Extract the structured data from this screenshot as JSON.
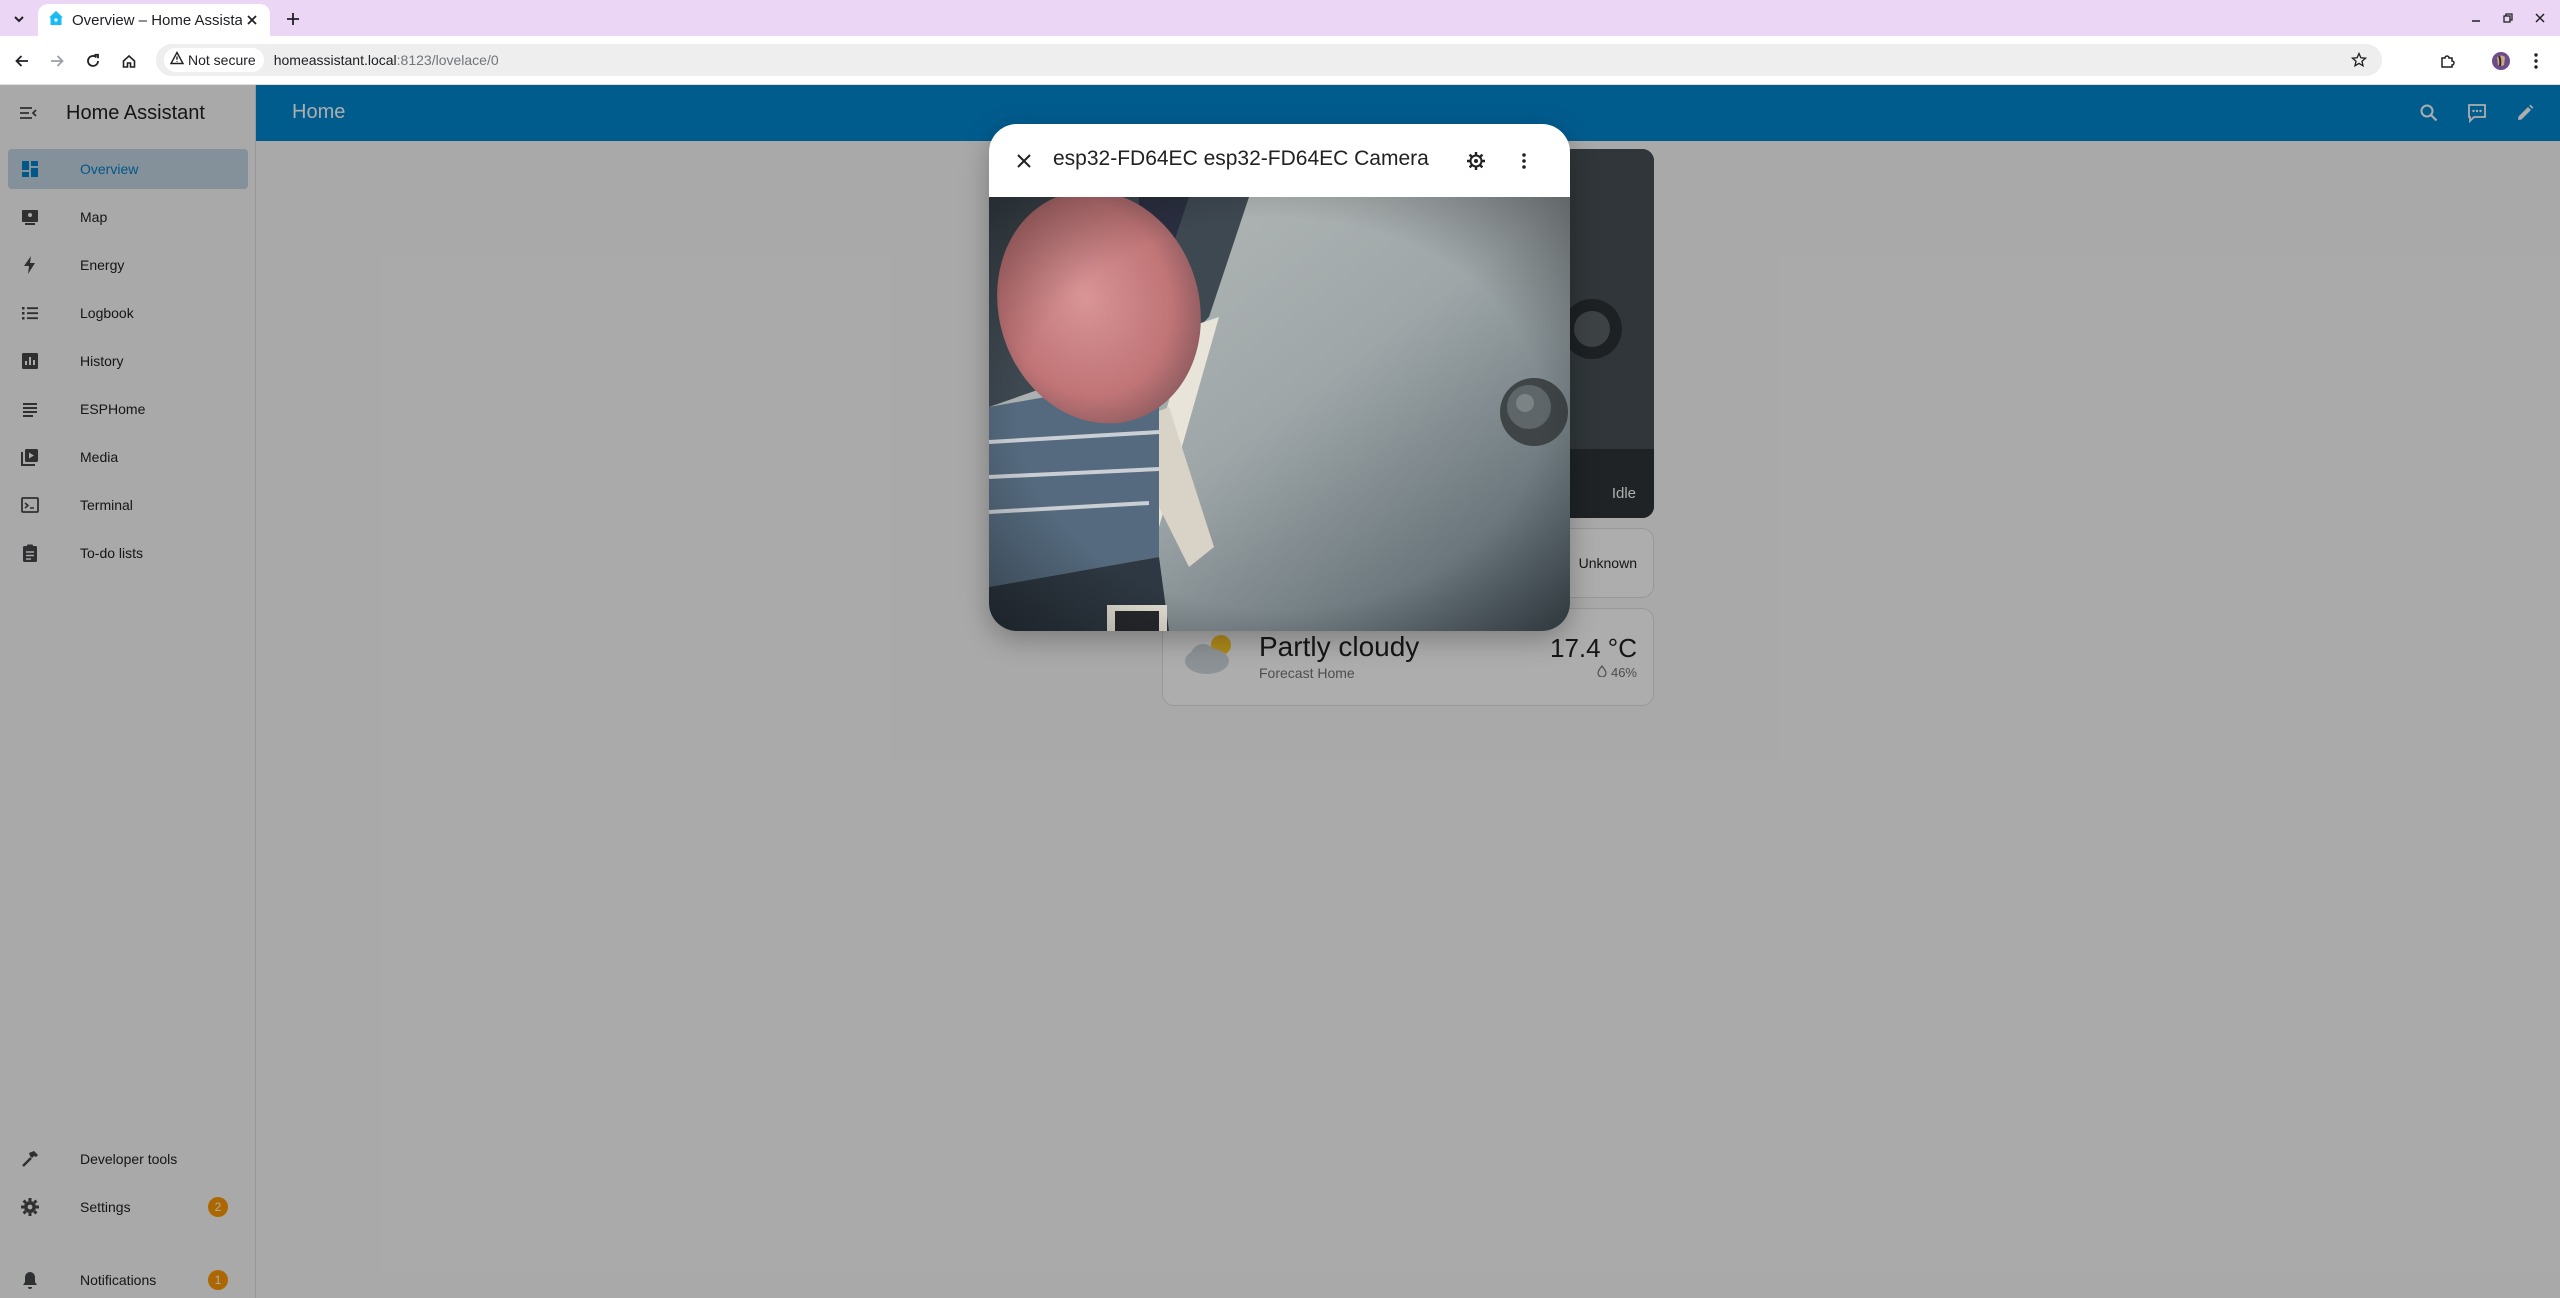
{
  "browser": {
    "tab_title": "Overview – Home Assistant",
    "security_label": "Not secure",
    "url_host": "homeassistant.local",
    "url_rest": ":8123/lovelace/0"
  },
  "app": {
    "title": "Home Assistant",
    "page_title": "Home"
  },
  "sidebar": {
    "items": [
      {
        "label": "Overview",
        "icon": "dashboard-icon"
      },
      {
        "label": "Map",
        "icon": "map-icon"
      },
      {
        "label": "Energy",
        "icon": "lightning-bolt-icon"
      },
      {
        "label": "Logbook",
        "icon": "list-icon"
      },
      {
        "label": "History",
        "icon": "chart-box-icon"
      },
      {
        "label": "ESPHome",
        "icon": "esphome-icon"
      },
      {
        "label": "Media",
        "icon": "play-box-multiple-icon"
      },
      {
        "label": "Terminal",
        "icon": "console-icon"
      },
      {
        "label": "To-do lists",
        "icon": "clipboard-list-icon"
      }
    ],
    "developer_tools": "Developer tools",
    "settings": "Settings",
    "settings_badge": "2",
    "notifications": "Notifications",
    "notifications_badge": "1"
  },
  "cards": {
    "camera_status": "Idle",
    "entity_state": "Unknown",
    "weather": {
      "state": "Partly cloudy",
      "name": "Forecast Home",
      "temperature": "17.4 °C",
      "humidity": "46%"
    }
  },
  "dialog": {
    "title": "esp32-FD64EC esp32-FD64EC Camera"
  },
  "colors": {
    "app_header": "#0288d1",
    "tab_strip": "#ecd6f5",
    "badge": "#ff9800",
    "active_nav": "#c3d6e3"
  }
}
